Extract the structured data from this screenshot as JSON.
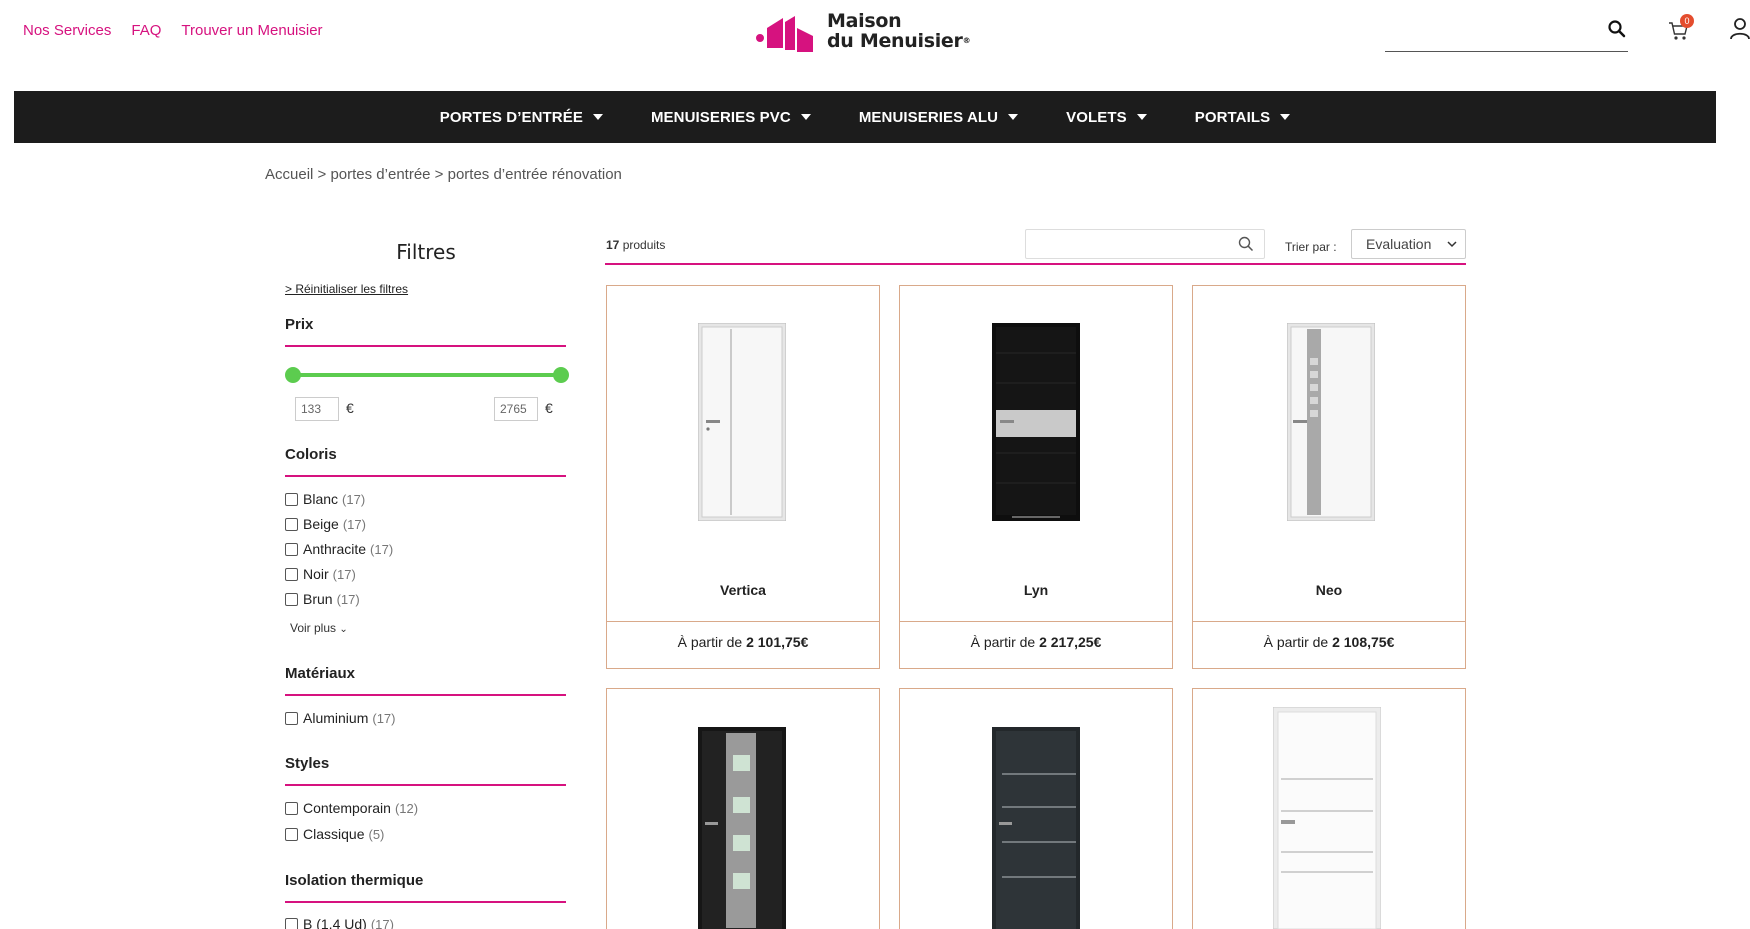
{
  "header": {
    "links": [
      "Nos Services",
      "FAQ",
      "Trouver un Menuisier"
    ],
    "logo_line1": "Maison",
    "logo_line2": "du Menuisier",
    "cart_count": "0"
  },
  "nav": {
    "items": [
      "PORTES D’ENTRÉE",
      "MENUISERIES PVC",
      "MENUISERIES ALU",
      "VOLETS",
      "PORTAILS"
    ]
  },
  "breadcrumb": "Accueil > portes d’entrée > portes d’entrée rénovation",
  "sidebar": {
    "title": "Filtres",
    "reset": "> Réinitialiser les filtres",
    "price": {
      "heading": "Prix",
      "min": "133",
      "max": "2765",
      "currency": "€"
    },
    "colors": {
      "heading": "Coloris",
      "options": [
        {
          "label": "Blanc",
          "count": "(17)"
        },
        {
          "label": "Beige",
          "count": "(17)"
        },
        {
          "label": "Anthracite",
          "count": "(17)"
        },
        {
          "label": "Noir",
          "count": "(17)"
        },
        {
          "label": "Brun",
          "count": "(17)"
        }
      ],
      "more": "Voir plus"
    },
    "materials": {
      "heading": "Matériaux",
      "options": [
        {
          "label": "Aluminium",
          "count": "(17)"
        }
      ]
    },
    "styles": {
      "heading": "Styles",
      "options": [
        {
          "label": "Contemporain",
          "count": "(12)"
        },
        {
          "label": "Classique",
          "count": "(5)"
        }
      ]
    },
    "isolation": {
      "heading": "Isolation thermique",
      "options": [
        {
          "label": "B (1,4 Ud)",
          "count": "(17)"
        }
      ]
    }
  },
  "products_header": {
    "count_number": "17",
    "count_label": "produits",
    "sort_label": "Trier par :",
    "sort_value": "Evaluation"
  },
  "products": [
    {
      "name": "Vertica",
      "price_prefix": "À partir de",
      "price": "2 101,75€",
      "door_color": "#f2f2f2"
    },
    {
      "name": "Lyn",
      "price_prefix": "À partir de",
      "price": "2 217,25€",
      "door_color": "#111111"
    },
    {
      "name": "Neo",
      "price_prefix": "À partir de",
      "price": "2 108,75€",
      "door_color": "#f2f2f2"
    },
    {
      "name": "",
      "price_prefix": "",
      "price": "",
      "door_color": "#1a1a1a"
    },
    {
      "name": "",
      "price_prefix": "",
      "price": "",
      "door_color": "#2b3034"
    },
    {
      "name": "",
      "price_prefix": "",
      "price": "",
      "door_color": "#f4f4f4"
    }
  ],
  "colors": {
    "accent": "#d6127f",
    "nav_bg": "#1c1c1c",
    "slider": "#5ccc4f",
    "card_border": "#d9a98a"
  }
}
